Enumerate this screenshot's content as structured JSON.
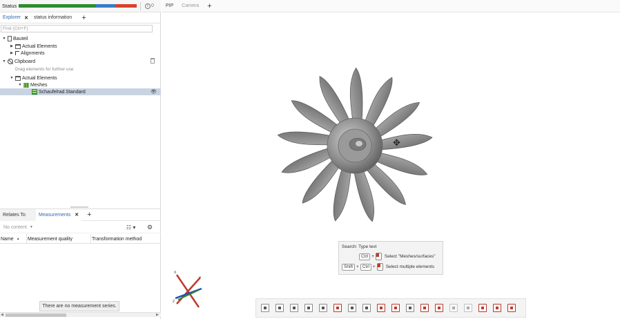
{
  "status": {
    "label": "Status",
    "bar_colors": [
      "#2e8b2e",
      "#3a7bc8",
      "#d9412b"
    ],
    "info_count": "0"
  },
  "explorer_tabs": [
    {
      "label": "Explorer",
      "active": true,
      "closable": true
    },
    {
      "label": "status information",
      "active": false,
      "closable": false
    }
  ],
  "find": {
    "placeholder": "Find (Ctrl+F)"
  },
  "tree": {
    "bauteil": "Bauteil",
    "actual_elements_1": "Actual Elements",
    "alignments": "Alignments",
    "clipboard": "Clipboard",
    "clipboard_hint": "Drag elements for further use",
    "actual_elements_2": "Actual Elements",
    "meshes": "Meshes",
    "mesh_item": "Schaufelrad.Standard"
  },
  "bottom_tabs": {
    "relates_to": "Relates To",
    "measurements": "Measurements"
  },
  "filter": {
    "no_content": "No content"
  },
  "columns": {
    "name": "Name",
    "quality": "Measurement quality",
    "transformation": "Transformation method"
  },
  "empty_message": "There are no measurement series.",
  "viewport_tabs": [
    {
      "label": "PIP",
      "active": true
    },
    {
      "label": "Camera",
      "active": false
    }
  ],
  "tooltip": {
    "title": "Search: Type text",
    "row1_key": "Ctrl",
    "row1_text": "Select \"Meshes/surfaces\"",
    "row2_key1": "Shift",
    "row2_key2": "Ctrl",
    "row2_text": "Select multiple elements"
  },
  "axes": {
    "x": "X",
    "y": "Y",
    "z": "Z"
  },
  "icons": {
    "toolbar": [
      "select-frame-icon",
      "select-line-icon",
      "select-point-icon",
      "select-both-icon",
      "measure-icon",
      "plane-icon",
      "section-1-icon",
      "section-2-icon",
      "ruler-icon",
      "box-icon",
      "fit-icon",
      "angle-icon",
      "link-icon",
      "grid-icon",
      "scale-icon",
      "check-icon",
      "delete-icon",
      "transform-icon"
    ]
  }
}
